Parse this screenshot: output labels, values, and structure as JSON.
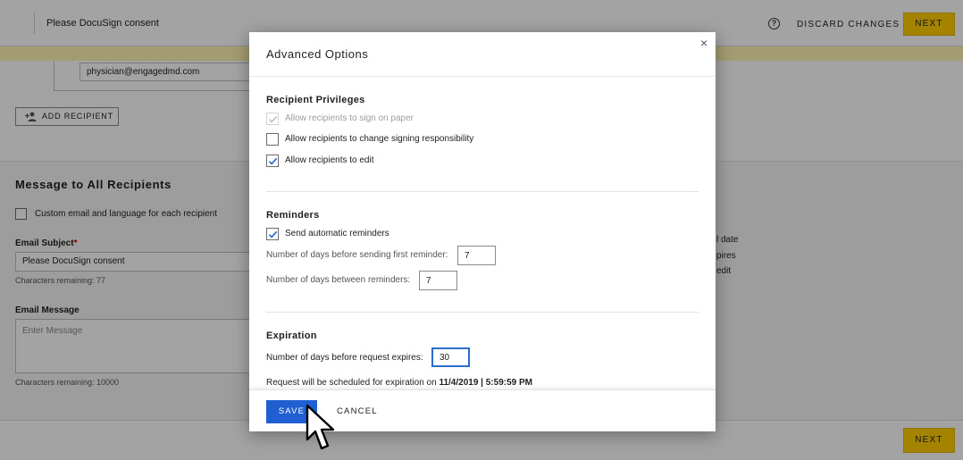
{
  "topbar": {
    "title": "Please DocuSign consent",
    "help_icon": "?",
    "discard_label": "DISCARD CHANGES",
    "next_label": "NEXT"
  },
  "recipient": {
    "email_value": "physician@engagedmd.com",
    "add_recipient_label": "ADD RECIPIENT"
  },
  "message": {
    "section_title": "Message to All Recipients",
    "custom_label": "Custom email and language for each recipient",
    "subject_label": "Email Subject",
    "subject_required": "*",
    "subject_value": "Please DocuSign consent",
    "subject_chars": "Characters remaining: 77",
    "body_label": "Email Message",
    "body_placeholder": "Enter Message",
    "body_chars": "Characters remaining: 10000"
  },
  "right_partial": [
    "l date",
    "pires",
    "edit"
  ],
  "bottombar": {
    "next_label": "NEXT"
  },
  "modal": {
    "title": "Advanced Options",
    "close_icon": "×",
    "privileges": {
      "title": "Recipient Privileges",
      "options": [
        {
          "label": "Allow recipients to sign on paper",
          "checked": true,
          "disabled": true
        },
        {
          "label": "Allow recipients to change signing responsibility",
          "checked": false,
          "disabled": false
        },
        {
          "label": "Allow recipients to edit",
          "checked": true,
          "disabled": false
        }
      ]
    },
    "reminders": {
      "title": "Reminders",
      "auto_label": "Send automatic reminders",
      "first_label": "Number of days before sending first reminder:",
      "first_value": "7",
      "between_label": "Number of days between reminders:",
      "between_value": "7"
    },
    "expiration": {
      "title": "Expiration",
      "days_label": "Number of days before request expires:",
      "days_value": "30",
      "sched_prefix": "Request will be scheduled for expiration on ",
      "sched_date": "11/4/2019 | 5:59:59 PM"
    },
    "save_label": "SAVE",
    "cancel_label": "CANCEL"
  },
  "colors": {
    "accent_blue": "#1f5fd1",
    "brand_yellow": "#ffce00",
    "focus_blue": "#2d6cc9"
  },
  "icons": {
    "help": "help-circle-icon",
    "add_recipient": "add-person-icon",
    "close": "close-icon",
    "check": "checkmark-icon",
    "cursor": "mouse-pointer-icon"
  }
}
